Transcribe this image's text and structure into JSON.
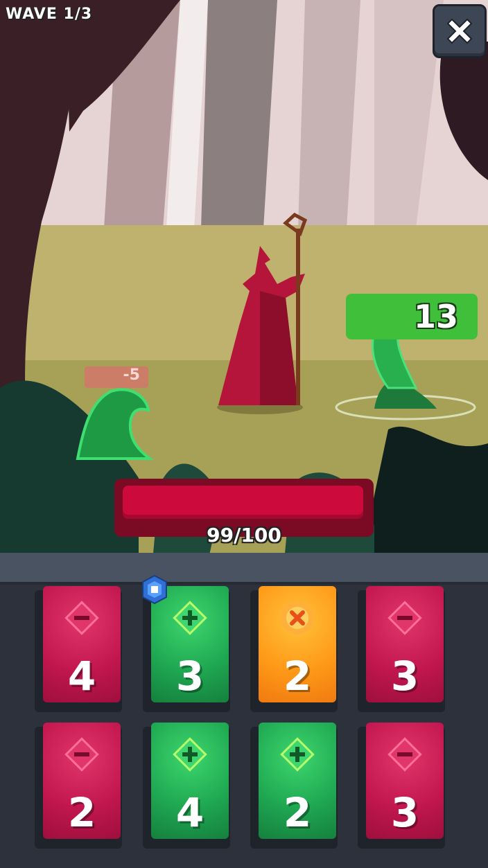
{
  "hud": {
    "wave_label": "WAVE 1/3",
    "close_icon": "close-icon"
  },
  "player": {
    "health_text": "99/100",
    "health_current": 99,
    "health_max": 100
  },
  "enemies": [
    {
      "name": "green-slime-left",
      "floating_text": "-5"
    },
    {
      "name": "green-slime-right",
      "value": "13"
    }
  ],
  "cards": [
    {
      "type": "minus",
      "color": "red",
      "value": "4"
    },
    {
      "type": "plus",
      "color": "green",
      "value": "3",
      "has_gem": true
    },
    {
      "type": "cancel",
      "color": "orange",
      "value": "2"
    },
    {
      "type": "minus",
      "color": "red",
      "value": "3"
    },
    {
      "type": "minus",
      "color": "red",
      "value": "2"
    },
    {
      "type": "plus",
      "color": "green",
      "value": "4"
    },
    {
      "type": "plus",
      "color": "green",
      "value": "2"
    },
    {
      "type": "minus",
      "color": "red",
      "value": "3"
    }
  ],
  "colors": {
    "red_card": "#c2174f",
    "green_card": "#1fa852",
    "orange_card": "#ff9a18",
    "health_bar": "#cc0b3c"
  }
}
